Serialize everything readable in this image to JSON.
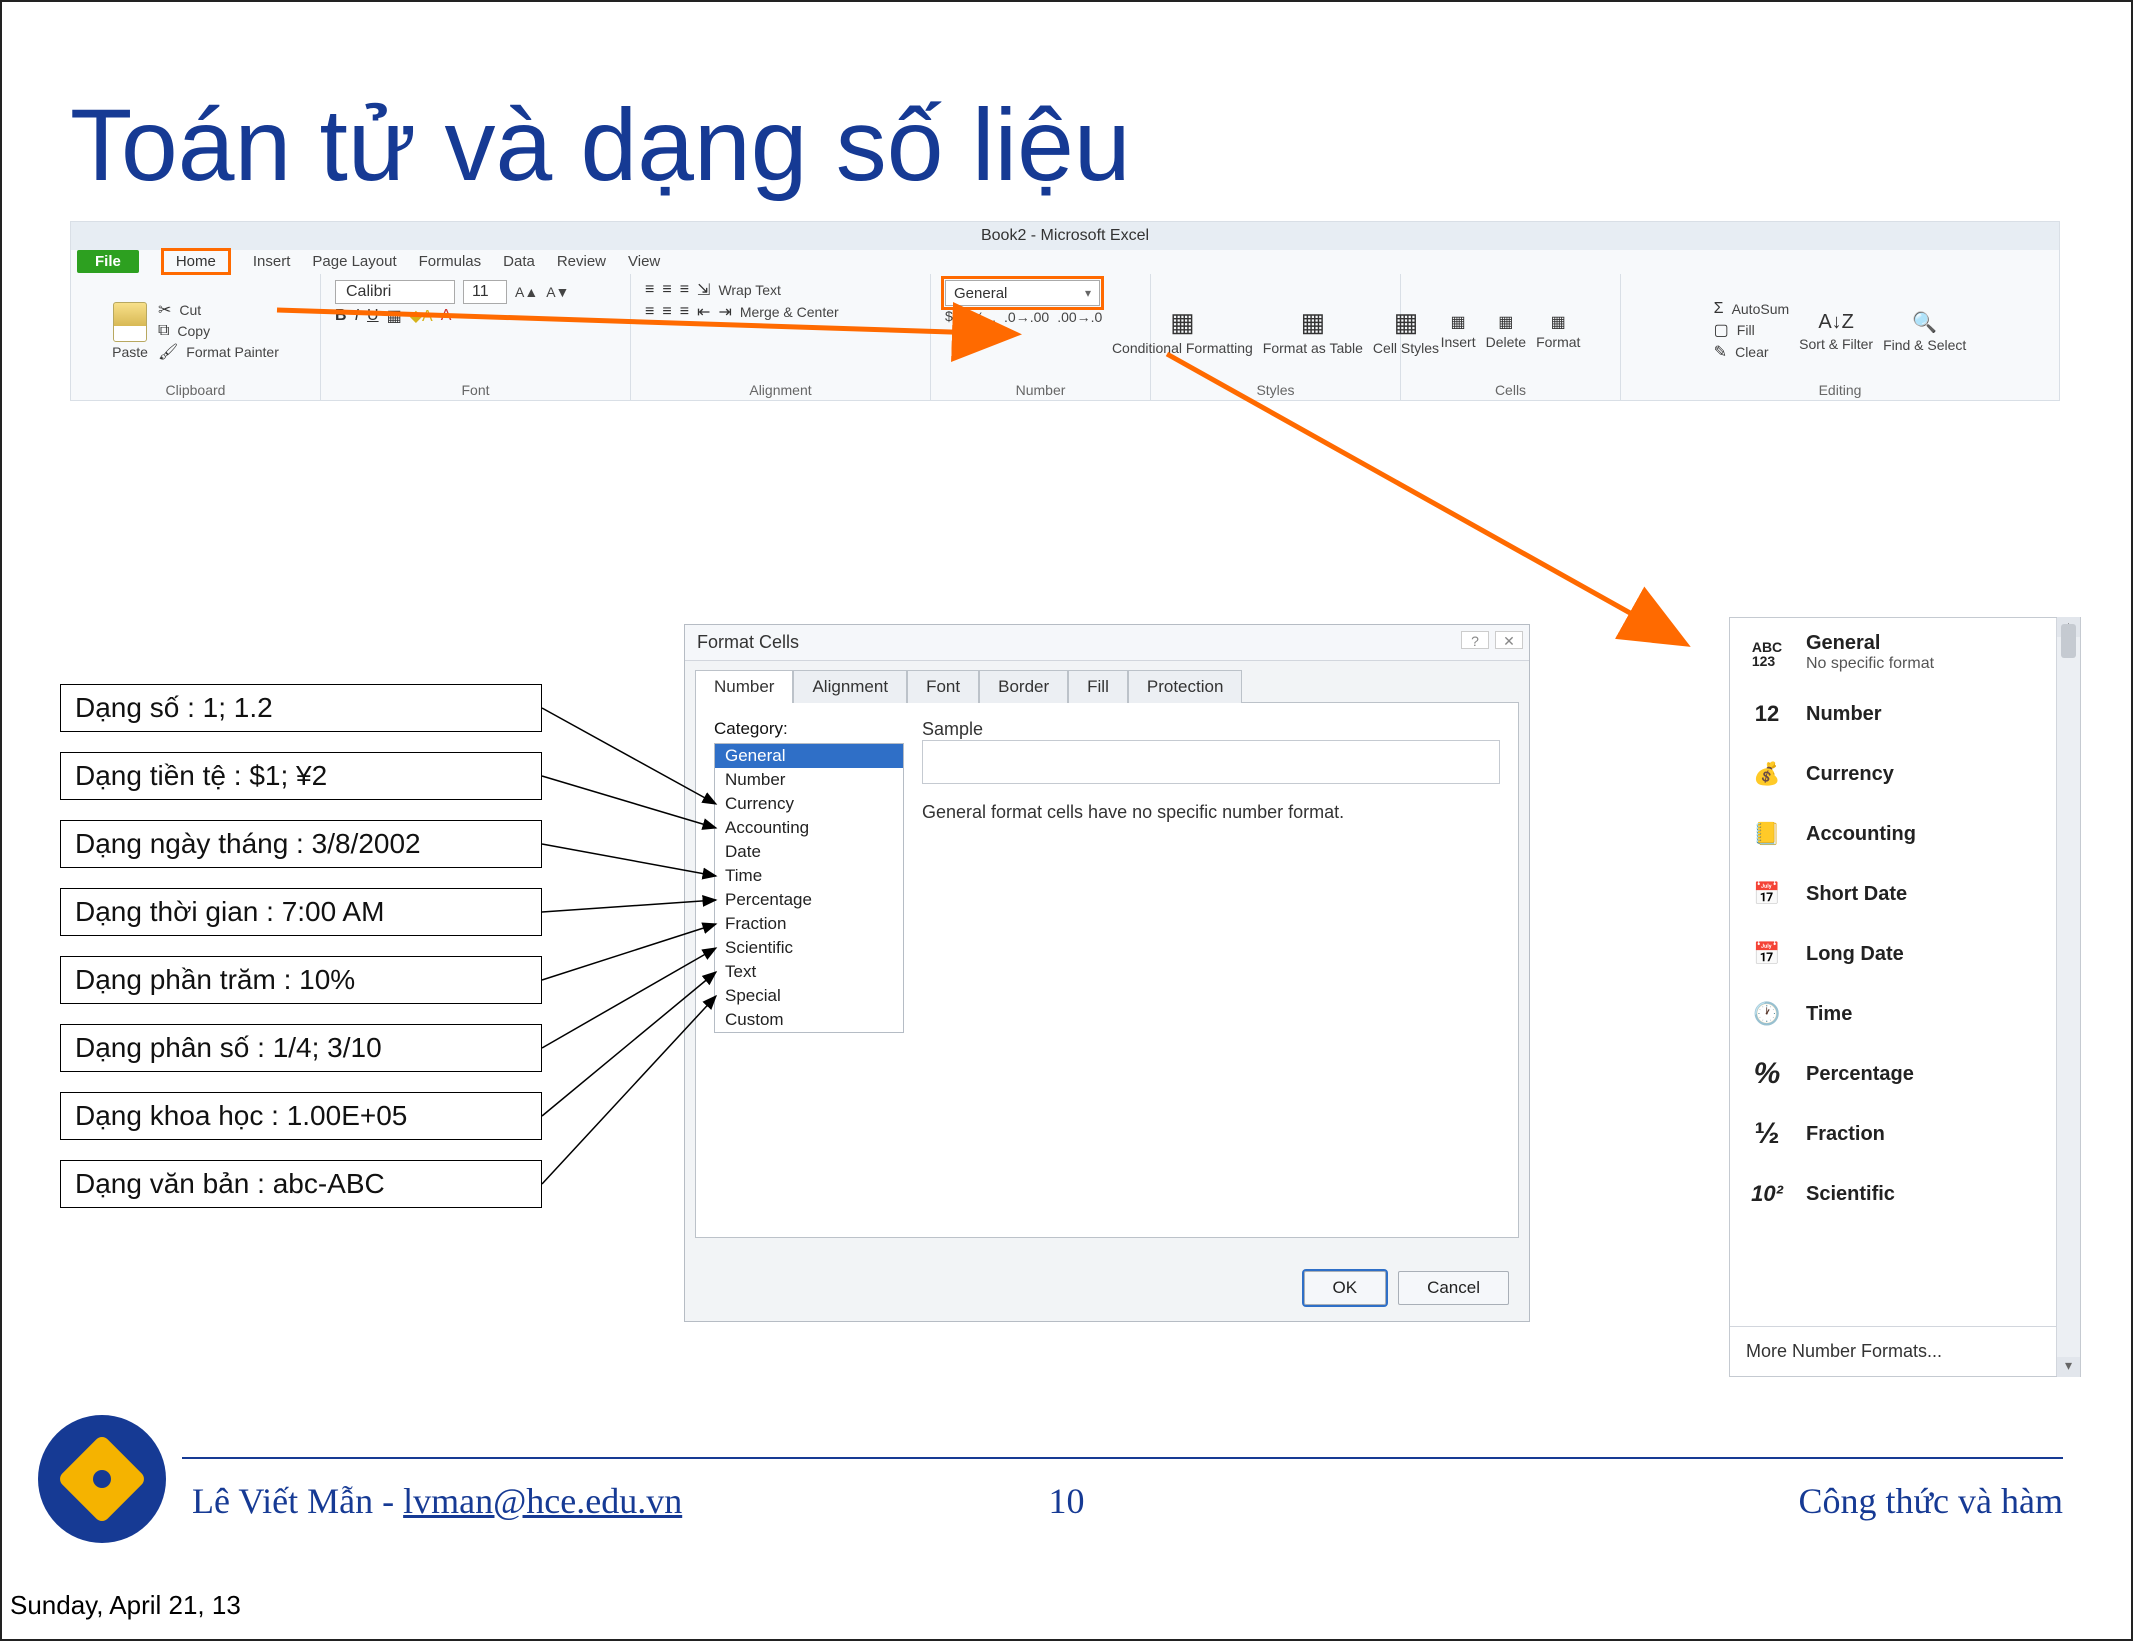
{
  "slide": {
    "title": "Toán tử và dạng số liệu",
    "author_line_name": "Lê Viết Mẫn",
    "author_line_sep": " - ",
    "author_line_email": "lvman@hce.edu.vn",
    "page_number": "10",
    "topic": "Công thức và hàm",
    "datestamp": "Sunday, April 21, 13"
  },
  "ribbon": {
    "app_title": "Book2 - Microsoft Excel",
    "tabs": {
      "file": "File",
      "home": "Home",
      "insert": "Insert",
      "page_layout": "Page Layout",
      "formulas": "Formulas",
      "data": "Data",
      "review": "Review",
      "view": "View"
    },
    "clipboard": {
      "paste": "Paste",
      "cut": "Cut",
      "copy": "Copy",
      "painter": "Format Painter",
      "label": "Clipboard"
    },
    "font": {
      "name": "Calibri",
      "size": "11",
      "label": "Font"
    },
    "alignment": {
      "wrap": "Wrap Text",
      "merge": "Merge & Center",
      "label": "Alignment"
    },
    "number": {
      "dropdown_value": "General",
      "label": "Number"
    },
    "styles": {
      "cond": "Conditional Formatting",
      "fmt": "Format as Table",
      "cell": "Cell Styles",
      "label": "Styles"
    },
    "cells": {
      "insert": "Insert",
      "delete": "Delete",
      "format": "Format",
      "label": "Cells"
    },
    "editing": {
      "autosum": "AutoSum",
      "fill": "Fill",
      "clear": "Clear",
      "sort": "Sort & Filter",
      "find": "Find & Select",
      "label": "Editing"
    }
  },
  "labels": [
    "Dạng số : 1; 1.2",
    "Dạng tiền tệ : $1; ¥2",
    "Dạng ngày tháng : 3/8/2002",
    "Dạng thời gian : 7:00 AM",
    "Dạng phần trăm : 10%",
    "Dạng phân số : 1/4; 3/10",
    "Dạng khoa học : 1.00E+05",
    "Dạng văn bản : abc-ABC"
  ],
  "dialog": {
    "title": "Format Cells",
    "tabs": [
      "Number",
      "Alignment",
      "Font",
      "Border",
      "Fill",
      "Protection"
    ],
    "category_label": "Category:",
    "categories": [
      "General",
      "Number",
      "Currency",
      "Accounting",
      "Date",
      "Time",
      "Percentage",
      "Fraction",
      "Scientific",
      "Text",
      "Special",
      "Custom"
    ],
    "sample_label": "Sample",
    "description": "General format cells have no specific number format.",
    "ok": "OK",
    "cancel": "Cancel"
  },
  "fmt_panel": {
    "items": [
      {
        "icon": "ABC123",
        "title": "General",
        "sub": "No specific format"
      },
      {
        "icon": "12",
        "title": "Number"
      },
      {
        "icon": "$",
        "title": "Currency"
      },
      {
        "icon": "ACC",
        "title": "Accounting"
      },
      {
        "icon": "📅",
        "title": "Short Date"
      },
      {
        "icon": "📅",
        "title": "Long Date"
      },
      {
        "icon": "🕐",
        "title": "Time"
      },
      {
        "icon": "%",
        "title": "Percentage"
      },
      {
        "icon": "½",
        "title": "Fraction"
      },
      {
        "icon": "10²",
        "title": "Scientific"
      }
    ],
    "footer": "More Number Formats..."
  }
}
